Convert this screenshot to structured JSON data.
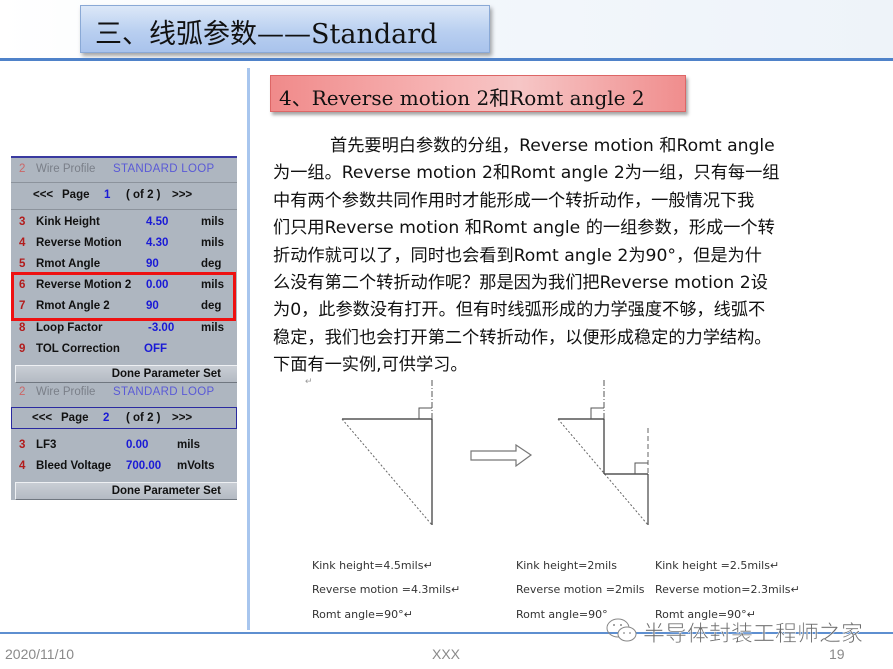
{
  "slide": {
    "title": "三、线弧参数——Standard",
    "section_header": "4、Reverse motion 2和Romt angle 2",
    "body_lines": [
      "首先要明白参数的分组，Reverse motion 和Romt angle",
      "为一组。Reverse motion 2和Romt angle 2为一组，只有每一组",
      "中有两个参数共同作用时才能形成一个转折动作，一般情况下我",
      "们只用Reverse motion 和Romt angle 的一组参数，形成一个转",
      "折动作就可以了，同时也会看到Romt angle 2为90°，但是为什",
      "么没有第二个转折动作呢？那是因为我们把Reverse motion 2设",
      "为0，此参数没有打开。但有时线弧形成的力学强度不够，线弧不",
      "稳定，我们也会打开第二个转折动作，以便形成稳定的力学结构。",
      "下面有一实例,可供学习。"
    ],
    "para_mark": "↵"
  },
  "panel": {
    "page1": {
      "wire_profile": {
        "num": "2",
        "label": "Wire Profile",
        "value": "STANDARD LOOP"
      },
      "pager": {
        "prev": "<<<",
        "label": "Page",
        "page": "1",
        "of": "( of 2 )",
        "next": ">>>"
      },
      "params": [
        {
          "num": "3",
          "label": "Kink Height",
          "value": "4.50",
          "unit": "mils"
        },
        {
          "num": "4",
          "label": "Reverse Motion",
          "value": "4.30",
          "unit": "mils"
        },
        {
          "num": "5",
          "label": "Rmot Angle",
          "value": "90",
          "unit": "deg"
        },
        {
          "num": "6",
          "label": "Reverse Motion 2",
          "value": "0.00",
          "unit": "mils"
        },
        {
          "num": "7",
          "label": "Rmot Angle 2",
          "value": "90",
          "unit": "deg"
        },
        {
          "num": "8",
          "label": "Loop Factor",
          "value": "-3.00",
          "unit": "mils"
        },
        {
          "num": "9",
          "label": "TOL Correction",
          "value": "OFF",
          "unit": ""
        }
      ],
      "done_button": "Done Parameter Set"
    },
    "page2": {
      "wire_profile": {
        "num": "2",
        "label": "Wire Profile",
        "value": "STANDARD LOOP"
      },
      "pager": {
        "prev": "<<<",
        "label": "Page",
        "page": "2",
        "of": "( of 2 )",
        "next": ">>>"
      },
      "params": [
        {
          "num": "3",
          "label": "LF3",
          "value": "0.00",
          "unit": "mils"
        },
        {
          "num": "4",
          "label": "Bleed Voltage",
          "value": "700.00",
          "unit": "mVolts"
        }
      ],
      "done_button": "Done Parameter Set"
    },
    "highlight_color": "#ee1111"
  },
  "captions": {
    "left": [
      "Kink height=4.5mils↵",
      "Reverse motion =4.3mils↵",
      "Romt angle=90°↵"
    ],
    "middle": [
      "Kink height=2mils",
      "Reverse motion =2mils",
      "Romt angle=90°"
    ],
    "right": [
      "Kink height  =2.5mils↵",
      "Reverse motion=2.3mils↵",
      "Romt angle=90°↵"
    ]
  },
  "footer": {
    "date": "2020/11/10",
    "center": "XXX",
    "page_number": "19",
    "watermark": "半导体封装工程师之家"
  },
  "colors": {
    "title_blue": "#b9cff0",
    "rule_blue": "#4f82c9",
    "section_red": "#f08a8a",
    "value_blue": "#1a1ad6",
    "param_num_red": "#b21b1b"
  }
}
